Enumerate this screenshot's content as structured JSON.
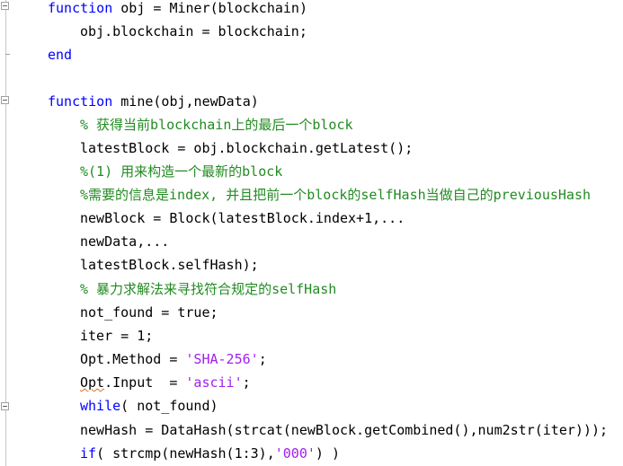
{
  "editor": {
    "colors": {
      "keyword": "#0000ff",
      "comment": "#228b22",
      "string": "#a020f0",
      "text": "#000000",
      "background": "#ffffff"
    },
    "lines": [
      {
        "segments": [
          {
            "text": "function",
            "type": "keyword"
          },
          {
            "text": " obj = Miner(blockchain)",
            "type": "text"
          }
        ]
      },
      {
        "segments": [
          {
            "text": "obj.blockchain = blockchain;",
            "type": "text"
          }
        ]
      },
      {
        "segments": [
          {
            "text": "end",
            "type": "keyword"
          }
        ]
      },
      {
        "segments": []
      },
      {
        "segments": [
          {
            "text": "function",
            "type": "keyword"
          },
          {
            "text": " mine(obj,newData)",
            "type": "text"
          }
        ]
      },
      {
        "segments": [
          {
            "text": "% 获得当前blockchain上的最后一个block",
            "type": "comment"
          }
        ]
      },
      {
        "segments": [
          {
            "text": "latestBlock = obj.blockchain.getLatest();",
            "type": "text"
          }
        ]
      },
      {
        "segments": [
          {
            "text": "%(1) 用来构造一个最新的block",
            "type": "comment"
          }
        ]
      },
      {
        "segments": [
          {
            "text": "%需要的信息是index, 并且把前一个block的selfHash当做自己的previousHash",
            "type": "comment"
          }
        ]
      },
      {
        "segments": [
          {
            "text": "newBlock = Block(latestBlock.index+1,...",
            "type": "text"
          }
        ]
      },
      {
        "segments": [
          {
            "text": "newData,...",
            "type": "text"
          }
        ]
      },
      {
        "segments": [
          {
            "text": "latestBlock.selfHash);",
            "type": "text"
          }
        ]
      },
      {
        "segments": [
          {
            "text": "% 暴力求解法来寻找符合规定的selfHash",
            "type": "comment"
          }
        ]
      },
      {
        "segments": [
          {
            "text": "not_found = true;",
            "type": "text"
          }
        ]
      },
      {
        "segments": [
          {
            "text": "iter = 1;",
            "type": "text"
          }
        ]
      },
      {
        "segments": [
          {
            "text": "Opt.Method = ",
            "type": "text"
          },
          {
            "text": "'SHA-256'",
            "type": "string"
          },
          {
            "text": ";",
            "type": "text"
          }
        ]
      },
      {
        "segments": [
          {
            "text": "Opt",
            "type": "warning"
          },
          {
            "text": ".Input  = ",
            "type": "text"
          },
          {
            "text": "'ascii'",
            "type": "string"
          },
          {
            "text": ";",
            "type": "text"
          }
        ]
      },
      {
        "segments": [
          {
            "text": "while",
            "type": "keyword"
          },
          {
            "text": "( not_found)",
            "type": "text"
          }
        ]
      },
      {
        "segments": [
          {
            "text": "newHash = DataHash(strcat(newBlock.getCombined(),num2str(iter)));",
            "type": "text"
          }
        ]
      },
      {
        "segments": [
          {
            "text": "if",
            "type": "keyword"
          },
          {
            "text": "( strcmp(newHash(1:3),",
            "type": "text"
          },
          {
            "text": "'000'",
            "type": "string"
          },
          {
            "text": ") )",
            "type": "text"
          }
        ]
      }
    ]
  }
}
